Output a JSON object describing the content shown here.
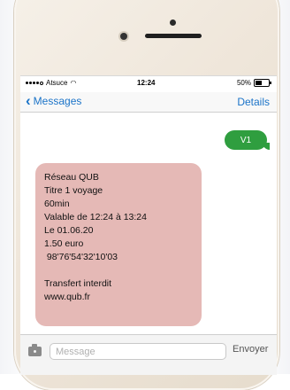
{
  "status_bar": {
    "carrier": "Atsuce",
    "time": "12:24",
    "battery": "50%",
    "battery_level": 0.5
  },
  "nav": {
    "back_label": "Messages",
    "details_label": "Details"
  },
  "conversation": {
    "sent_message": "V1",
    "received_lines": [
      "Réseau QUB",
      "Titre 1 voyage",
      "60min",
      "Valable de 12:24 à 13:24",
      "Le 01.06.20",
      "1.50 euro",
      " 98'76'54'32'10'03",
      "",
      "Transfert interdit",
      "www.qub.fr"
    ]
  },
  "composer": {
    "placeholder": "Message",
    "send_label": "Envoyer"
  },
  "colors": {
    "accent": "#1a73c8",
    "sent_bubble": "#2f9e3f",
    "received_bubble": "#e5b9b6"
  },
  "icons": [
    "wifi-icon",
    "signal-icon",
    "battery-icon",
    "chevron-left-icon",
    "camera-icon"
  ]
}
